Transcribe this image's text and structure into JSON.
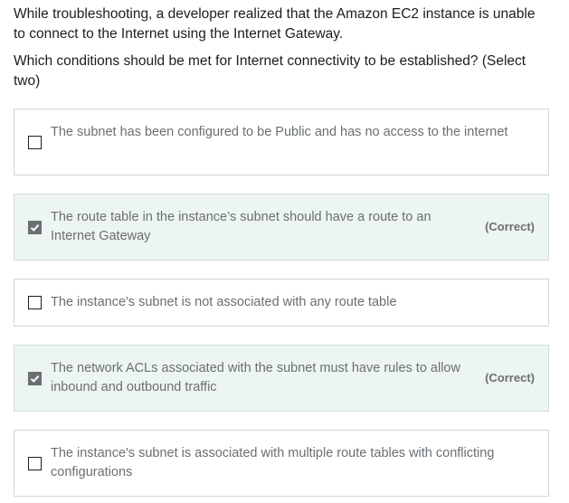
{
  "question": {
    "prompt": "While troubleshooting, a developer realized that the Amazon EC2 instance is unable to connect to the Internet using the Internet Gateway.",
    "instruction": "Which conditions should be met for Internet connectivity to be established? (Select two)"
  },
  "options": [
    {
      "label": "The subnet has been configured to be Public and has no access to the internet",
      "checked": false,
      "tag": ""
    },
    {
      "label": "The route table in the instance’s subnet should have a route to an Internet Gateway",
      "checked": true,
      "tag": "(Correct)"
    },
    {
      "label": "The instance's subnet is not associated with any route table",
      "checked": false,
      "tag": ""
    },
    {
      "label": "The network ACLs associated with the subnet must have rules to allow inbound and outbound traffic",
      "checked": true,
      "tag": "(Correct)"
    },
    {
      "label": "The instance's subnet is associated with multiple route tables with conflicting configurations",
      "checked": false,
      "tag": ""
    }
  ],
  "colors": {
    "correct_bg": "#edf5f2",
    "text_muted": "#6a6f73",
    "text": "#1c1d1f"
  },
  "icons": {
    "checkbox_checked": "checkmark-icon"
  }
}
